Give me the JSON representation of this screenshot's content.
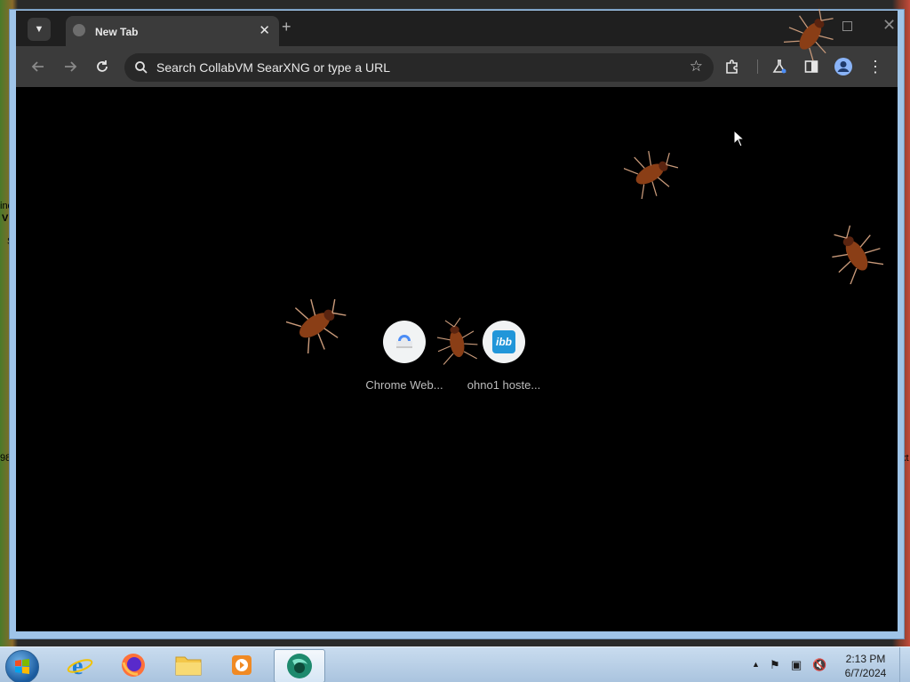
{
  "desktop": {
    "fragments": [
      "ind",
      "VI",
      "Su",
      "98",
      "xt"
    ]
  },
  "browser": {
    "tab": {
      "title": "New Tab",
      "close_glyph": "✕"
    },
    "new_tab_glyph": "+",
    "window_controls": {
      "close_glyph": "✕"
    },
    "omnibox": {
      "placeholder": "Search CollabVM SearXNG or type a URL"
    },
    "shortcuts": [
      {
        "label": "Chrome Web...",
        "icon": "chrome-web-store-icon"
      },
      {
        "label": "ohno1 hoste...",
        "icon": "ibb-icon",
        "icon_text": "ibb"
      }
    ]
  },
  "taskbar": {
    "apps": [
      "internet-explorer-icon",
      "firefox-icon",
      "file-explorer-icon",
      "media-player-icon",
      "collabvm-browser-icon"
    ],
    "clock": {
      "time": "2:13 PM",
      "date": "6/7/2024"
    }
  },
  "colors": {
    "page_bg": "#000000",
    "toolbar": "#3b3b3b",
    "titlebar": "#1f1f1f",
    "taskbar": "#b9d0e8"
  }
}
